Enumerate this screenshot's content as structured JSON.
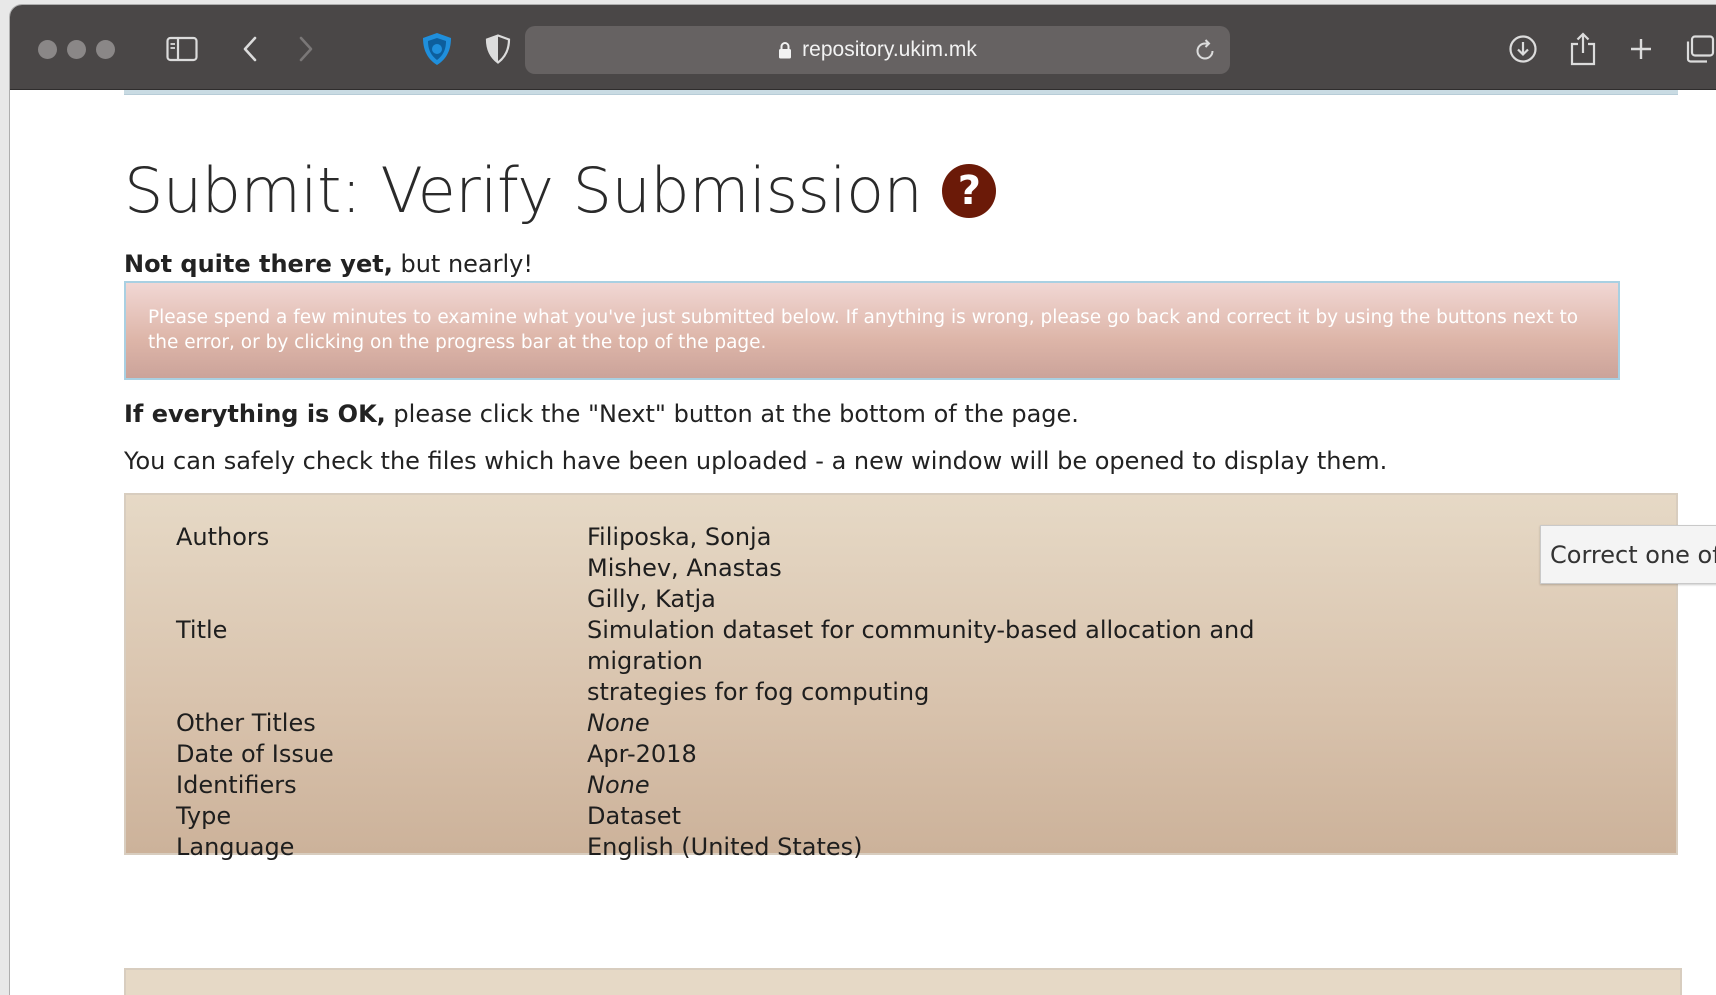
{
  "browser": {
    "url": "repository.ukim.mk",
    "traffic_lights": [
      "close",
      "minimize",
      "zoom"
    ],
    "toolbar_icons": [
      "sidebar-icon",
      "back-icon",
      "forward-icon",
      "ublock-icon",
      "privacy-shield-icon",
      "lock-icon",
      "reload-icon",
      "download-icon",
      "share-icon",
      "new-tab-icon",
      "tab-overview-icon"
    ]
  },
  "page": {
    "title": "Submit: Verify Submission",
    "help_glyph": "?",
    "subtitle_bold": "Not quite there yet,",
    "subtitle_rest": " but nearly!",
    "alert_text": "Please spend a few minutes to examine what you've just submitted below. If anything is wrong, please go back and correct it by using the buttons next to the error, or by clicking on the progress bar at the top of the page.",
    "ok_bold": "If everything is OK,",
    "ok_rest": " please click the \"Next\" button at the bottom of the page.",
    "files_note": "You can safely check the files which have been uploaded - a new window will be opened to display them."
  },
  "review": {
    "correct_button": "Correct one of these",
    "rows": [
      {
        "label": "Authors",
        "values": [
          "Filiposka, Sonja",
          "Mishev, Anastas",
          "Gilly, Katja"
        ],
        "italic": false
      },
      {
        "label": "Title",
        "values": [
          "Simulation dataset for community-based allocation and migration",
          "strategies for fog computing"
        ],
        "italic": false
      },
      {
        "label": "Other Titles",
        "values": [
          "None"
        ],
        "italic": true
      },
      {
        "label": "Date of Issue",
        "values": [
          "Apr-2018"
        ],
        "italic": false
      },
      {
        "label": "Identifiers",
        "values": [
          "None"
        ],
        "italic": true
      },
      {
        "label": "Type",
        "values": [
          "Dataset"
        ],
        "italic": false
      },
      {
        "label": "Language",
        "values": [
          "English (United States)"
        ],
        "italic": false
      }
    ]
  }
}
